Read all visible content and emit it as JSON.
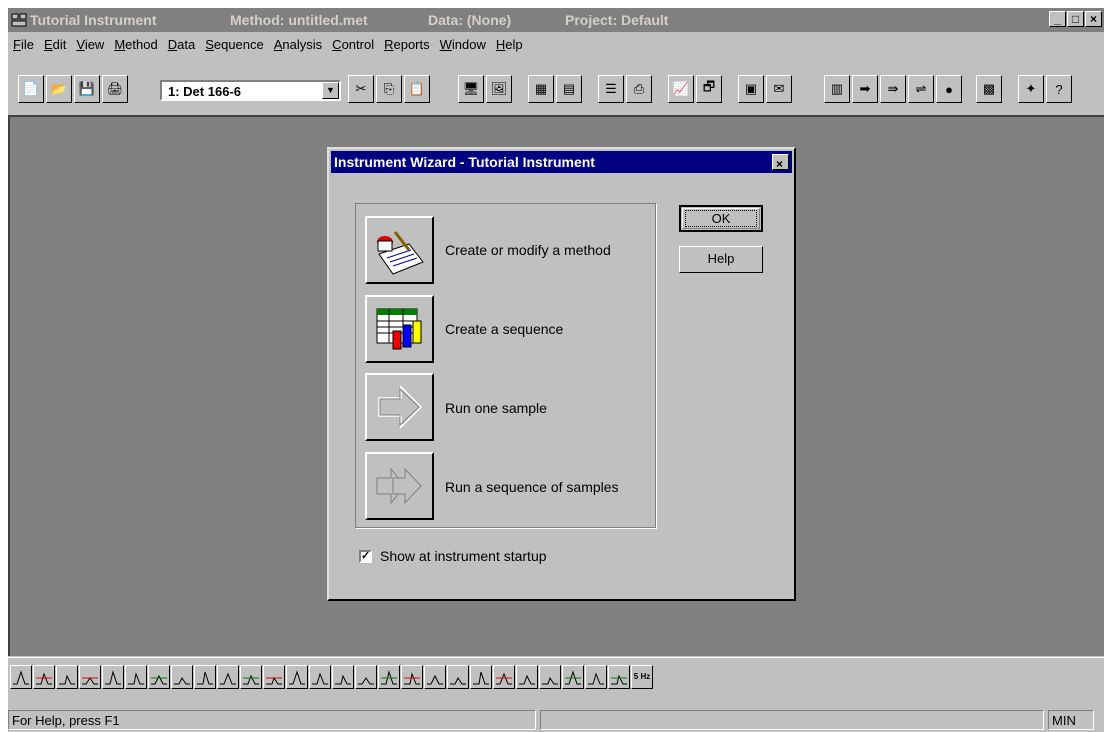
{
  "titlebar": {
    "app": "Tutorial Instrument",
    "method": "Method: untitled.met",
    "data": "Data: (None)",
    "project": "Project: Default"
  },
  "window_controls": {
    "minimize": "_",
    "maximize": "□",
    "close": "×"
  },
  "menu": {
    "items": [
      {
        "pre": "",
        "u": "F",
        "post": "ile"
      },
      {
        "pre": "",
        "u": "E",
        "post": "dit"
      },
      {
        "pre": "",
        "u": "V",
        "post": "iew"
      },
      {
        "pre": "",
        "u": "M",
        "post": "ethod"
      },
      {
        "pre": "",
        "u": "D",
        "post": "ata"
      },
      {
        "pre": "",
        "u": "S",
        "post": "equence"
      },
      {
        "pre": "",
        "u": "A",
        "post": "nalysis"
      },
      {
        "pre": "",
        "u": "C",
        "post": "ontrol"
      },
      {
        "pre": "",
        "u": "R",
        "post": "eports"
      },
      {
        "pre": "",
        "u": "W",
        "post": "indow"
      },
      {
        "pre": "",
        "u": "H",
        "post": "elp"
      }
    ]
  },
  "toolbar": {
    "detector_select": "1: Det 166-6",
    "buttons": [
      "new-icon",
      "open-icon",
      "save-icon",
      "print-icon",
      "cut-icon",
      "copy-icon",
      "paste-icon",
      "monitor-icon",
      "image-icon",
      "table-icon",
      "grid-icon",
      "list-icon",
      "export-icon",
      "graph-icon",
      "properties-icon",
      "calculator-icon",
      "report-icon",
      "chart-icon",
      "run-arrow-icon",
      "run-double-arrow-icon",
      "flow-icon",
      "stop-icon",
      "palette-icon",
      "wand-icon",
      "help-icon"
    ]
  },
  "dialog": {
    "title": "Instrument Wizard - Tutorial Instrument",
    "close": "×",
    "options": [
      {
        "label": "Create or modify a method",
        "icon": "method-icon"
      },
      {
        "label": "Create a sequence",
        "icon": "sequence-icon"
      },
      {
        "label": "Run one sample",
        "icon": "arrow-icon"
      },
      {
        "label": "Run a sequence of samples",
        "icon": "double-arrow-icon"
      }
    ],
    "ok_label": "OK",
    "help_label": "Help",
    "startup_checkbox": {
      "label": "Show at instrument startup",
      "checked": true,
      "mark": "✓"
    }
  },
  "integration_toolbar": {
    "count": 28,
    "last_label": "5 Hz"
  },
  "statusbar": {
    "help_text": "For Help, press F1",
    "mode": "MIN"
  }
}
